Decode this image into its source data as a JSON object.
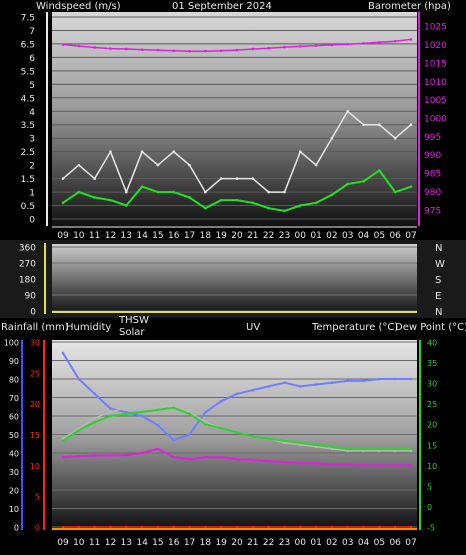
{
  "header": {
    "left": "Windspeed (m/s)",
    "center": "01 September 2024",
    "right": "Barometer (hpa)"
  },
  "x_ticks": [
    "09",
    "10",
    "11",
    "12",
    "13",
    "14",
    "15",
    "16",
    "17",
    "18",
    "19",
    "20",
    "21",
    "22",
    "23",
    "00",
    "01",
    "02",
    "03",
    "04",
    "05",
    "06",
    "07"
  ],
  "wind_panel": {
    "ticks": [
      "7.5",
      "7",
      "6.5",
      "6",
      "5.5",
      "5",
      "4.5",
      "4",
      "3.5",
      "3",
      "2.5",
      "2",
      "1.5",
      "1",
      "0.5",
      "0"
    ],
    "baro_ticks": [
      "1025",
      "1020",
      "1015",
      "1010",
      "1005",
      "1000",
      "995",
      "990",
      "985",
      "980",
      "975"
    ]
  },
  "dir_panel": {
    "ticks": [
      "360",
      "270",
      "180",
      "90",
      "0"
    ],
    "compass": [
      "N",
      "W",
      "S",
      "E",
      "N"
    ]
  },
  "bottom_header": {
    "rainfall": "Rainfall (mm)",
    "humidity": "Humidity",
    "thsw": "THSW",
    "solar": "Solar",
    "uv": "UV",
    "temperature": "Temperature (°C)",
    "dew_point": "Dew Point (°C)"
  },
  "bottom_panel": {
    "humidity_ticks": [
      "100",
      "90",
      "80",
      "70",
      "60",
      "50",
      "40",
      "30",
      "20",
      "10",
      "0"
    ],
    "rain_ticks": [
      "30",
      "25",
      "20",
      "15",
      "10",
      "5",
      "0"
    ],
    "temp_ticks": [
      "40",
      "35",
      "30",
      "25",
      "20",
      "15",
      "10",
      "5",
      "0",
      "-5"
    ]
  },
  "colors": {
    "wind_gust": "#e8e8e8",
    "wind_avg": "#22e022",
    "barometer": "#e020e0",
    "humidity": "#6f7fff",
    "temperature": "#30d030",
    "thsw": "#b8b8b8",
    "dew_point": "#e020e0",
    "rain_axis": "#ff2020",
    "humidity_axis": "#4050ff",
    "temp_axis": "#30d030",
    "dir_axis": "#e0e040"
  },
  "chart_data": [
    {
      "type": "line",
      "x": [
        "09",
        "10",
        "11",
        "12",
        "13",
        "14",
        "15",
        "16",
        "17",
        "18",
        "19",
        "20",
        "21",
        "22",
        "23",
        "00",
        "01",
        "02",
        "03",
        "04",
        "05",
        "06",
        "07"
      ],
      "ylabel": "Windspeed (m/s)",
      "ylim": [
        0,
        7.5
      ],
      "y2label": "Barometer (hpa)",
      "y2lim": [
        972.5,
        1027.5
      ],
      "series": [
        {
          "name": "Windspeed (m/s)",
          "axis": "left",
          "values": [
            1.5,
            2.0,
            1.5,
            2.5,
            1.0,
            2.5,
            2.0,
            2.5,
            2.0,
            1.0,
            1.5,
            1.5,
            1.5,
            1.0,
            1.0,
            2.5,
            2.0,
            3.0,
            4.0,
            3.5,
            3.5,
            3.0,
            3.5
          ]
        },
        {
          "name": "",
          "axis": "left",
          "values": [
            0.6,
            1.0,
            0.8,
            0.7,
            0.5,
            1.2,
            1.0,
            1.0,
            0.8,
            0.4,
            0.7,
            0.7,
            0.6,
            0.4,
            0.3,
            0.5,
            0.6,
            0.9,
            1.3,
            1.4,
            1.8,
            1.0,
            1.2
          ]
        },
        {
          "name": "Barometer (hpa)",
          "axis": "right",
          "values": [
            1020.0,
            1019.6,
            1019.2,
            1018.9,
            1018.8,
            1018.6,
            1018.5,
            1018.3,
            1018.2,
            1018.2,
            1018.3,
            1018.5,
            1018.8,
            1019.0,
            1019.3,
            1019.5,
            1019.7,
            1019.9,
            1020.1,
            1020.3,
            1020.6,
            1020.9,
            1021.4
          ]
        }
      ]
    },
    {
      "type": "line",
      "x": [
        "09",
        "10",
        "11",
        "12",
        "13",
        "14",
        "15",
        "16",
        "17",
        "18",
        "19",
        "20",
        "21",
        "22",
        "23",
        "00",
        "01",
        "02",
        "03",
        "04",
        "05",
        "06",
        "07"
      ],
      "ylabel": "",
      "ylim": [
        0,
        360
      ],
      "series": []
    },
    {
      "type": "line",
      "x": [
        "09",
        "10",
        "11",
        "12",
        "13",
        "14",
        "15",
        "16",
        "17",
        "18",
        "19",
        "20",
        "21",
        "22",
        "23",
        "00",
        "01",
        "02",
        "03",
        "04",
        "05",
        "06",
        "07"
      ],
      "ylabel": "Humidity",
      "ylim": [
        0,
        100
      ],
      "y2label": "Temperature (°C)",
      "y2lim": [
        -5,
        40
      ],
      "rain_lim": [
        0,
        30
      ],
      "series": [
        {
          "name": "Humidity",
          "axis": "humidity",
          "values": [
            94,
            80,
            72,
            64,
            62,
            60,
            55,
            47,
            50,
            62,
            68,
            72,
            74,
            76,
            78,
            76,
            77,
            78,
            79,
            79,
            80,
            80,
            80
          ]
        },
        {
          "name": "Temperature (°C)",
          "axis": "temperature",
          "values": [
            16.0,
            18.5,
            20.5,
            22.0,
            22.5,
            23.0,
            23.5,
            24.0,
            22.5,
            20.0,
            19.0,
            18.0,
            17.0,
            16.5,
            16.0,
            15.5,
            15.0,
            14.5,
            14.0,
            14.0,
            14.0,
            14.0,
            14.0
          ]
        },
        {
          "name": "THSW",
          "axis": "temperature",
          "values": [
            16.5,
            19.0,
            21.5,
            23.0,
            24.0,
            25.0,
            24.0,
            24.5,
            23.0,
            20.5,
            19.0,
            18.0,
            17.0,
            16.5,
            15.5,
            15.0,
            14.5,
            14.0,
            13.5,
            13.5,
            13.5,
            13.5,
            13.5
          ]
        },
        {
          "name": "Dew Point (°C)",
          "axis": "temperature",
          "values": [
            12.0,
            12.2,
            12.4,
            12.4,
            12.5,
            13.0,
            14.0,
            12.0,
            11.5,
            12.0,
            12.0,
            11.5,
            11.3,
            11.0,
            10.8,
            10.5,
            10.5,
            10.2,
            10.2,
            10.0,
            10.0,
            10.0,
            10.0
          ]
        },
        {
          "name": "Rainfall (mm)",
          "axis": "rain",
          "values": [
            0,
            0,
            0,
            0,
            0,
            0,
            0,
            0,
            0,
            0,
            0,
            0,
            0,
            0,
            0,
            0,
            0,
            0,
            0,
            0,
            0,
            0,
            0
          ]
        }
      ]
    }
  ]
}
